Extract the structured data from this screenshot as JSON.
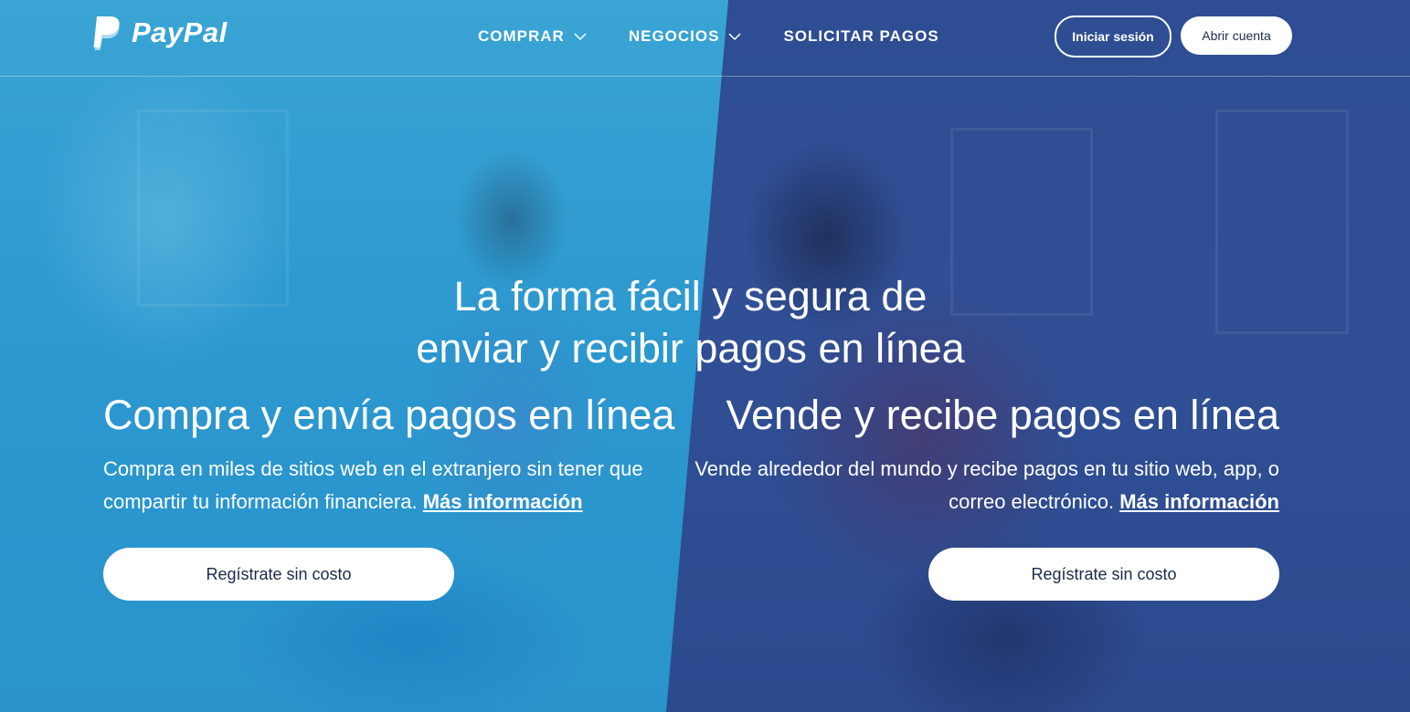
{
  "brand": {
    "name": "PayPal"
  },
  "nav": {
    "items": [
      {
        "label": "COMPRAR",
        "has_dropdown": true
      },
      {
        "label": "NEGOCIOS",
        "has_dropdown": true
      },
      {
        "label": "SOLICITAR PAGOS",
        "has_dropdown": false
      }
    ]
  },
  "auth": {
    "login_label": "Iniciar sesión",
    "signup_label": "Abrir cuenta"
  },
  "hero": {
    "headline_line1": "La forma fácil y segura de",
    "headline_line2": "enviar y recibir pagos en línea",
    "left": {
      "title": "Compra y envía pagos en línea",
      "description": "Compra en miles de sitios web en el extranjero sin tener que compartir tu información financiera.",
      "link_label": "Más información",
      "cta_label": "Regístrate sin costo"
    },
    "right": {
      "title": "Vende y recibe pagos en línea",
      "description": "Vende alrededor del mundo y recibe pagos en tu sitio web, app, o correo electrónico.",
      "link_label": "Más información",
      "cta_label": "Regístrate sin costo"
    }
  },
  "colors": {
    "left_panel": "#2b98cf",
    "right_panel": "#2f4e93",
    "text": "#ffffff",
    "button_bg": "#ffffff",
    "button_text": "#1c2a4a"
  }
}
